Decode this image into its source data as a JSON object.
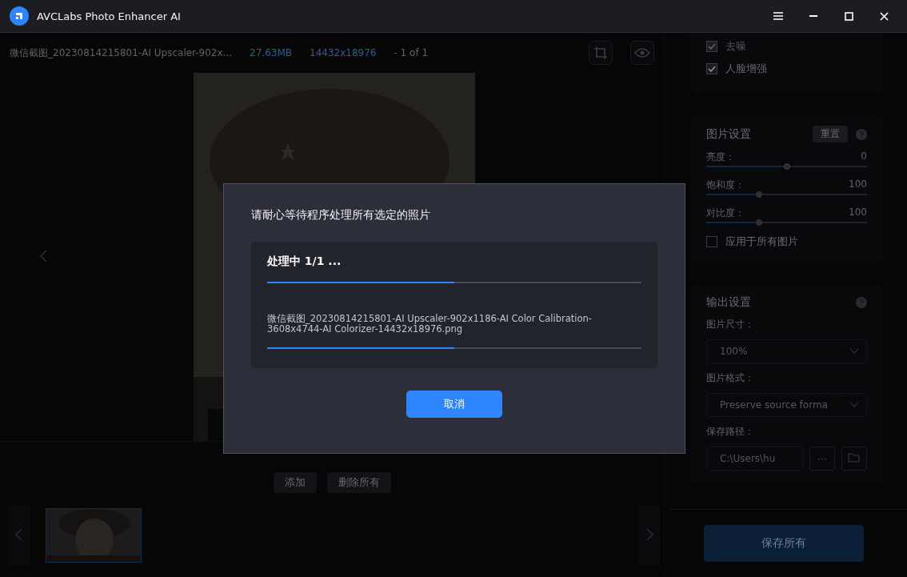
{
  "window": {
    "title": "AVCLabs Photo Enhancer AI"
  },
  "file_info": {
    "name": "微信截图_20230814215801-AI Upscaler-902x...",
    "size": "27.63MB",
    "dimensions": "14432x18976",
    "position": "- 1 of 1"
  },
  "preview": {
    "kind": "picture"
  },
  "list_buttons": [
    "添加",
    "删除所有"
  ],
  "thumbnails": [
    {
      "kind": "picture",
      "selected": true
    }
  ],
  "ai_options": [
    {
      "label": "去噪",
      "checked": true,
      "disabled": true
    },
    {
      "label": "人脸增强",
      "checked": true,
      "disabled": false
    }
  ],
  "image_settings": {
    "title": "图片设置",
    "reset": "重置",
    "sliders": [
      {
        "label": "亮度：",
        "reading": "0",
        "level": 0.5
      },
      {
        "label": "饱和度：",
        "reading": "100",
        "level": 0.33
      },
      {
        "label": "对比度：",
        "reading": "100",
        "level": 0.33
      }
    ],
    "apply_all": {
      "label": "应用于所有图片",
      "checked": false
    }
  },
  "output_settings": {
    "title": "输出设置",
    "size_label": "图片尺寸：",
    "size_value": "100%",
    "format_label": "图片格式：",
    "format_value": "Preserve source forma",
    "path_label": "保存路径：",
    "path_value": "C:\\Users\\hu",
    "more": "···"
  },
  "save_all": "保存所有",
  "dialog": {
    "title": "请耐心等待程序处理所有选定的照片",
    "status": "处理中 1/1 ...",
    "overall_progress": {
      "level": 0.5
    },
    "filename": "微信截图_20230814215801-AI Upscaler-902x1186-AI Color Calibration-3608x4744-AI Colorizer-14432x18976.png",
    "file_progress": {
      "level": 0.5
    },
    "cancel": "取消"
  }
}
